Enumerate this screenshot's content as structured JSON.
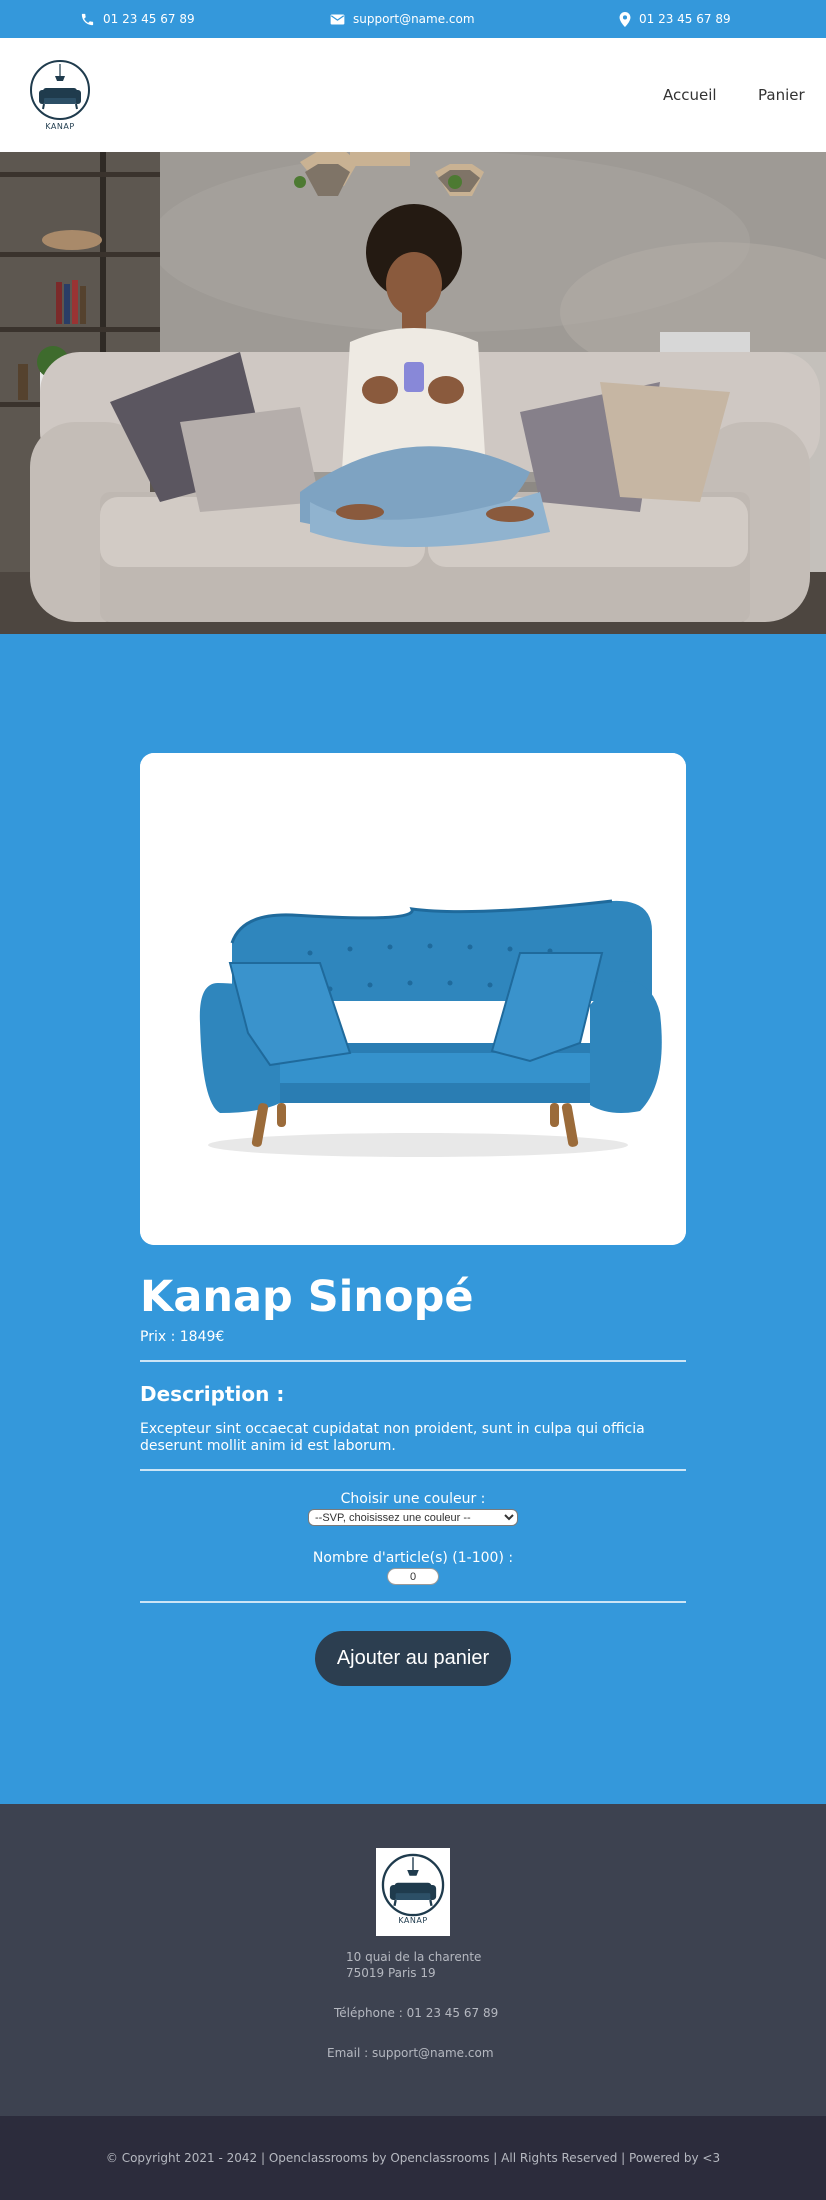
{
  "topbar": {
    "phone_left": "01 23 45 67 89",
    "email": "support@name.com",
    "phone_right": "01 23 45 67 89"
  },
  "header": {
    "logo_text": "KANAP",
    "nav": {
      "home": "Accueil",
      "cart": "Panier"
    }
  },
  "product": {
    "title": "Kanap Sinopé",
    "price_label": "Prix : ",
    "price": "1849",
    "currency": "€",
    "description_title": "Description :",
    "description": "Excepteur sint occaecat cupidatat non proident, sunt in culpa qui officia deserunt mollit anim id est laborum.",
    "color_label": "Choisir une couleur :",
    "color_selected": "--SVP, choisissez une couleur --",
    "quantity_label": "Nombre d'article(s) (1-100) :",
    "quantity_value": "0",
    "add_button": "Ajouter au panier"
  },
  "footer": {
    "logo_text": "KANAP",
    "address_line1": "10 quai de la charente",
    "address_line2": "75019 Paris 19",
    "phone": "Téléphone : 01 23 45 67 89",
    "email": "Email : support@name.com",
    "copyright": "© Copyright 2021 - 2042 | Openclassrooms by Openclassrooms | All Rights Reserved | Powered by <3"
  },
  "colors": {
    "primary": "#3498db",
    "footer": "#3d4250",
    "copyright_bar": "#2c2c3c",
    "button": "#2c3e50",
    "sofa_blue": "#2f86bd"
  }
}
